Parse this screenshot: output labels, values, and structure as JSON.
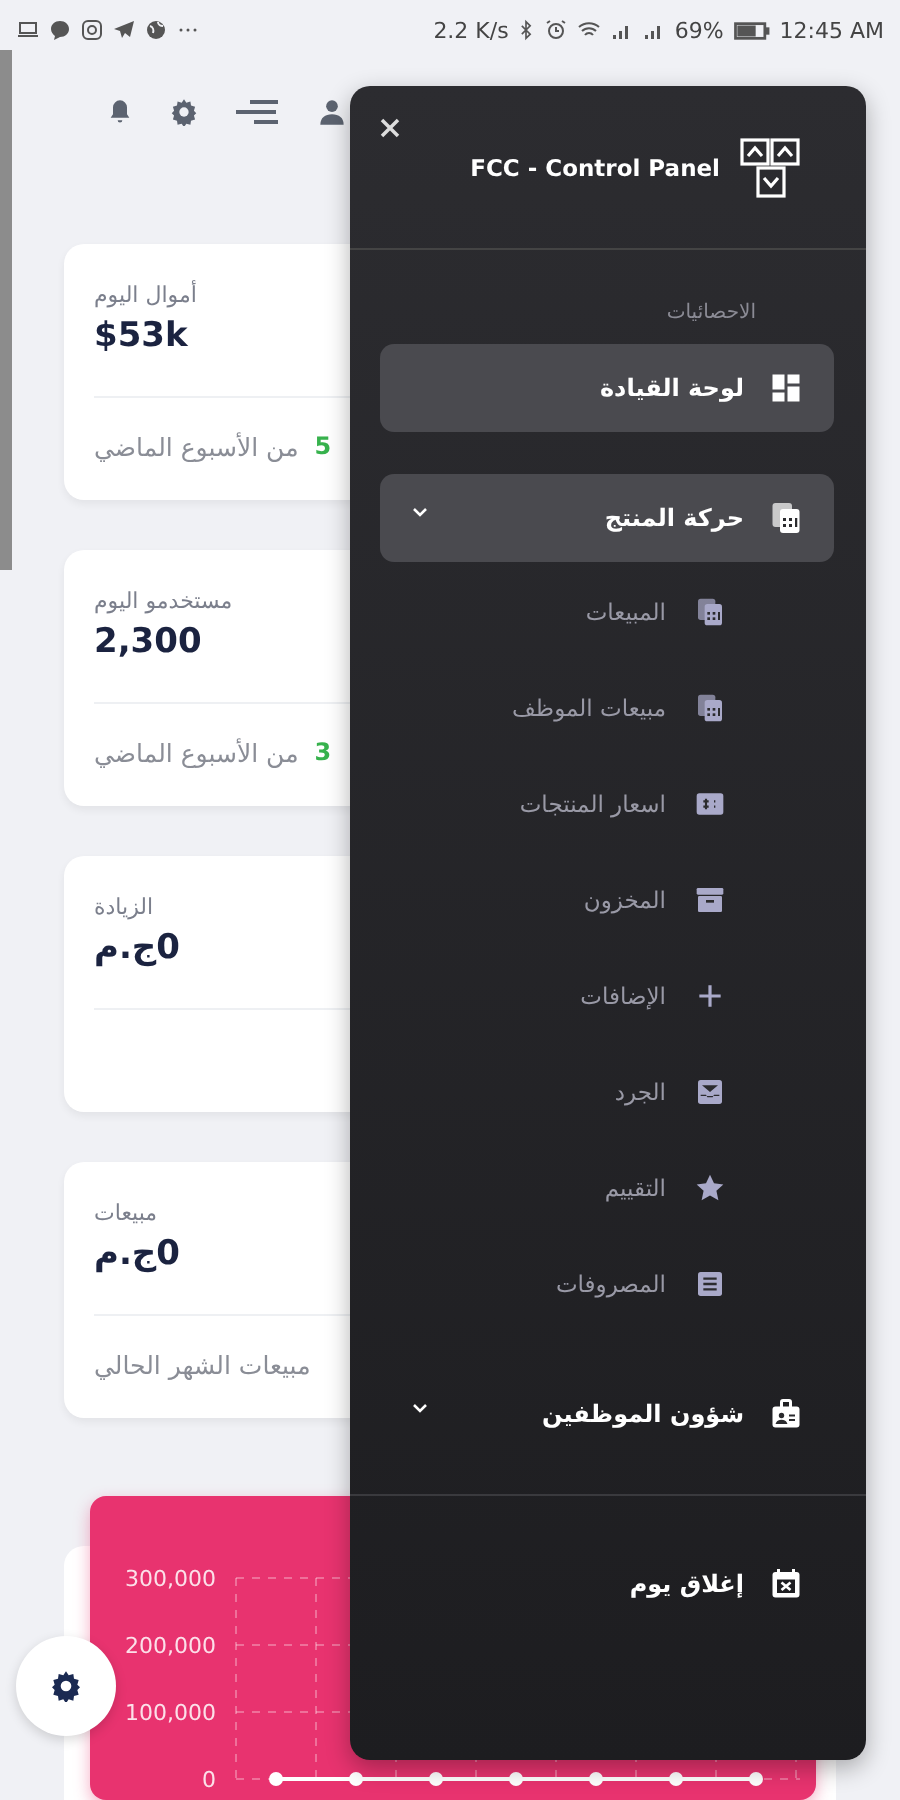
{
  "status_bar": {
    "net_speed": "2.2 K/s",
    "battery": "69%",
    "time": "12:45 AM"
  },
  "cards": [
    {
      "label": "أموال اليوم",
      "value": "$53k",
      "footer": "من الأسبوع الماضي",
      "change": "5"
    },
    {
      "label": "مستخدمو اليوم",
      "value": "2,300",
      "footer": "من الأسبوع الماضي",
      "change": "3"
    },
    {
      "label": "الزيادة",
      "value": "0ج.م"
    },
    {
      "label": "مبيعات",
      "value": "0ج.م",
      "footer": "مبيعات الشهر الحالي"
    }
  ],
  "chart": {
    "chart_data": {
      "type": "line",
      "marker": "circle",
      "values": [
        0,
        0,
        0,
        0,
        0,
        0,
        0
      ],
      "ylim": [
        0,
        300000
      ],
      "yticks": [
        {
          "value": 300000,
          "label": "300,000"
        },
        {
          "value": 200000,
          "label": "200,000"
        },
        {
          "value": 100000,
          "label": "100,000"
        },
        {
          "value": 0,
          "label": "0"
        }
      ]
    }
  },
  "drawer": {
    "title": "FCC - Control Panel",
    "section": "الاحصائيات",
    "items": [
      {
        "kind": "link",
        "label": "لوحة القيادة",
        "selected": true
      },
      {
        "kind": "group",
        "label": "حركة المنتج",
        "selected": true,
        "children": [
          {
            "label": "المبيعات",
            "selected": false
          },
          {
            "label": "مبيعات الموظف",
            "selected": false
          },
          {
            "label": "اسعار المنتجات",
            "selected": false
          },
          {
            "label": "المخزون",
            "selected": false
          },
          {
            "label": "الإضافات",
            "selected": false
          },
          {
            "label": "الجرد",
            "selected": false
          },
          {
            "label": "التقييم",
            "selected": false
          },
          {
            "label": "المصروفات",
            "selected": false
          }
        ]
      },
      {
        "kind": "group",
        "label": "شؤون الموظفين",
        "selected": false
      }
    ],
    "footer_items": [
      {
        "label": "إغلاق يوم",
        "selected": false
      }
    ]
  }
}
